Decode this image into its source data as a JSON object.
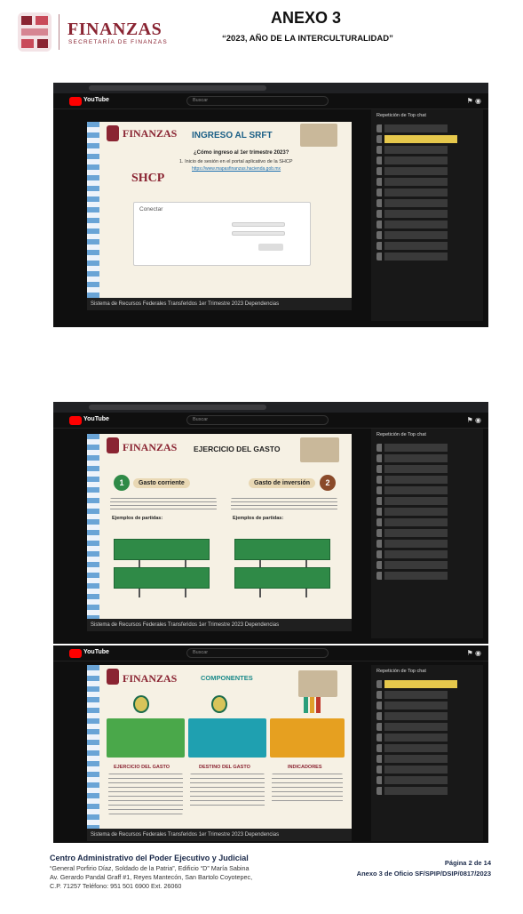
{
  "header": {
    "org_name": "FINANZAS",
    "org_subtitle": "SECRETARÍA DE FINANZAS",
    "title": "ANEXO 3",
    "motto": "“2023, AÑO DE LA INTERCULTURALIDAD”"
  },
  "youtube": {
    "logo_text": "YouTube",
    "search_placeholder": "Buscar",
    "chat_header": "Repetición de Top chat"
  },
  "slides": [
    {
      "brand": "FINANZAS",
      "title": "INGRESO AL SRFT",
      "question": "¿Cómo ingreso al 1er trimestre 2023?",
      "body": "1. Inicio de sesión en el portal aplicativo de la SHCP",
      "link": "https://www.mapasfinanzas.hacienda.gob.mx",
      "shcp": "SHCP",
      "login_heading": "Conectar",
      "caption": "Sistema de Recursos Federales Transferidos 1er Trimestre 2023 Dependencias"
    },
    {
      "brand": "FINANZAS",
      "title": "EJERCICIO DEL GASTO",
      "left_heading": "Gasto corriente",
      "right_heading": "Gasto de inversión",
      "num_left": "1",
      "num_right": "2",
      "left_examples": "Ejemplos de partidas:",
      "right_examples": "Ejemplos de partidas:",
      "caption": "Sistema de Recursos Federales Transferidos 1er Trimestre 2023 Dependencias"
    },
    {
      "brand": "FINANZAS",
      "title": "COMPONENTES",
      "col1": "EJERCICIO DEL GASTO",
      "col2": "DESTINO DEL GASTO",
      "col3": "INDICADORES",
      "caption": "Sistema de Recursos Federales Transferidos 1er Trimestre 2023 Dependencias"
    }
  ],
  "footer": {
    "org": "Centro Administrativo del Poder Ejecutivo y Judicial",
    "line1": "“General Porfirio Díaz, Soldado de la Patria”, Edificio “D” María Sabina",
    "line2": "Av. Gerardo Pandal Graff #1, Reyes Mantecón, San Bartolo Coyotepec,",
    "line3": "C.P. 71257    Teléfono: 951 501 6900 Ext. 26060",
    "page": "Página 2 de 14",
    "reference": "Anexo 3 de Oficio SF/SPIP/DSIP/0817/2023"
  },
  "colors": {
    "brand": "#8a2432",
    "slide_title": "#1b5f86",
    "yt_red": "#ff0000"
  }
}
